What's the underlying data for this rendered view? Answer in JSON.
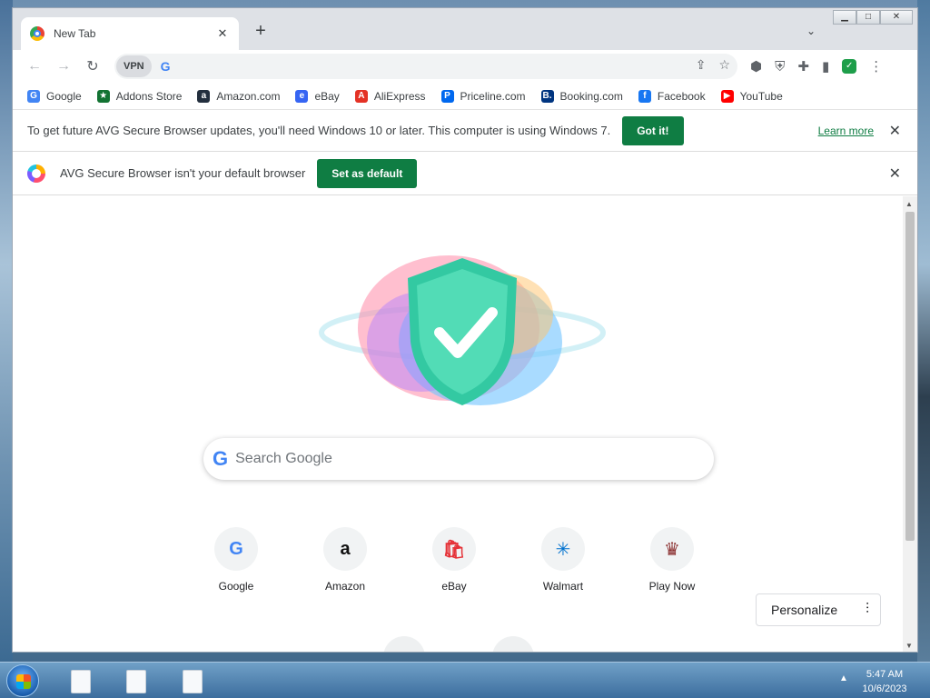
{
  "tab": {
    "title": "New Tab",
    "close": "✕",
    "new_tab": "+",
    "search_tabs": "⌄"
  },
  "window_controls": {
    "minimize": "▁",
    "maximize": "□",
    "close": "✕"
  },
  "toolbar": {
    "back": "←",
    "forward": "→",
    "reload": "↻",
    "vpn": "VPN",
    "omnibox_value": "",
    "omni_engine": "G"
  },
  "bookmarks": [
    {
      "label": "Google",
      "icon": "google-icon",
      "color": "#4285f4",
      "glyph": "G"
    },
    {
      "label": "Addons Store",
      "icon": "addons-store-icon",
      "color": "#137333",
      "glyph": "★"
    },
    {
      "label": "Amazon.com",
      "icon": "amazon-icon",
      "color": "#232f3e",
      "glyph": "a"
    },
    {
      "label": "eBay",
      "icon": "ebay-icon",
      "color": "#3665f3",
      "glyph": "e"
    },
    {
      "label": "AliExpress",
      "icon": "aliexpress-icon",
      "color": "#e43225",
      "glyph": "A"
    },
    {
      "label": "Priceline.com",
      "icon": "priceline-icon",
      "color": "#0068ef",
      "glyph": "P"
    },
    {
      "label": "Booking.com",
      "icon": "booking-icon",
      "color": "#003580",
      "glyph": "B."
    },
    {
      "label": "Facebook",
      "icon": "facebook-icon",
      "color": "#1877f2",
      "glyph": "f"
    },
    {
      "label": "YouTube",
      "icon": "youtube-icon",
      "color": "#ff0000",
      "glyph": "▶"
    }
  ],
  "update_bar": {
    "text": "To get future AVG Secure Browser updates, you'll need Windows 10 or later. This computer is using Windows 7.",
    "button": "Got it!",
    "link": "Learn more"
  },
  "default_bar": {
    "text": "AVG Secure Browser isn't your default browser",
    "button": "Set as default"
  },
  "search": {
    "placeholder": "Search Google",
    "engine_glyph": "G"
  },
  "shortcuts": [
    {
      "label": "Google",
      "glyph": "G",
      "color": "#4285f4"
    },
    {
      "label": "Amazon",
      "glyph": "a",
      "color": "#111111"
    },
    {
      "label": "eBay",
      "glyph": "🛍",
      "color": "#e53238"
    },
    {
      "label": "Walmart",
      "glyph": "✳",
      "color": "#0071ce"
    },
    {
      "label": "Play Now",
      "glyph": "♛",
      "color": "#8a2e2e"
    }
  ],
  "personalize": {
    "label": "Personalize"
  },
  "taskbar": {
    "time": "5:47 AM",
    "date": "10/6/2023"
  },
  "colors": {
    "avg_green": "#0f7d43",
    "tab_strip": "#dee1e6",
    "shield_teal": "#2ec4a0"
  }
}
